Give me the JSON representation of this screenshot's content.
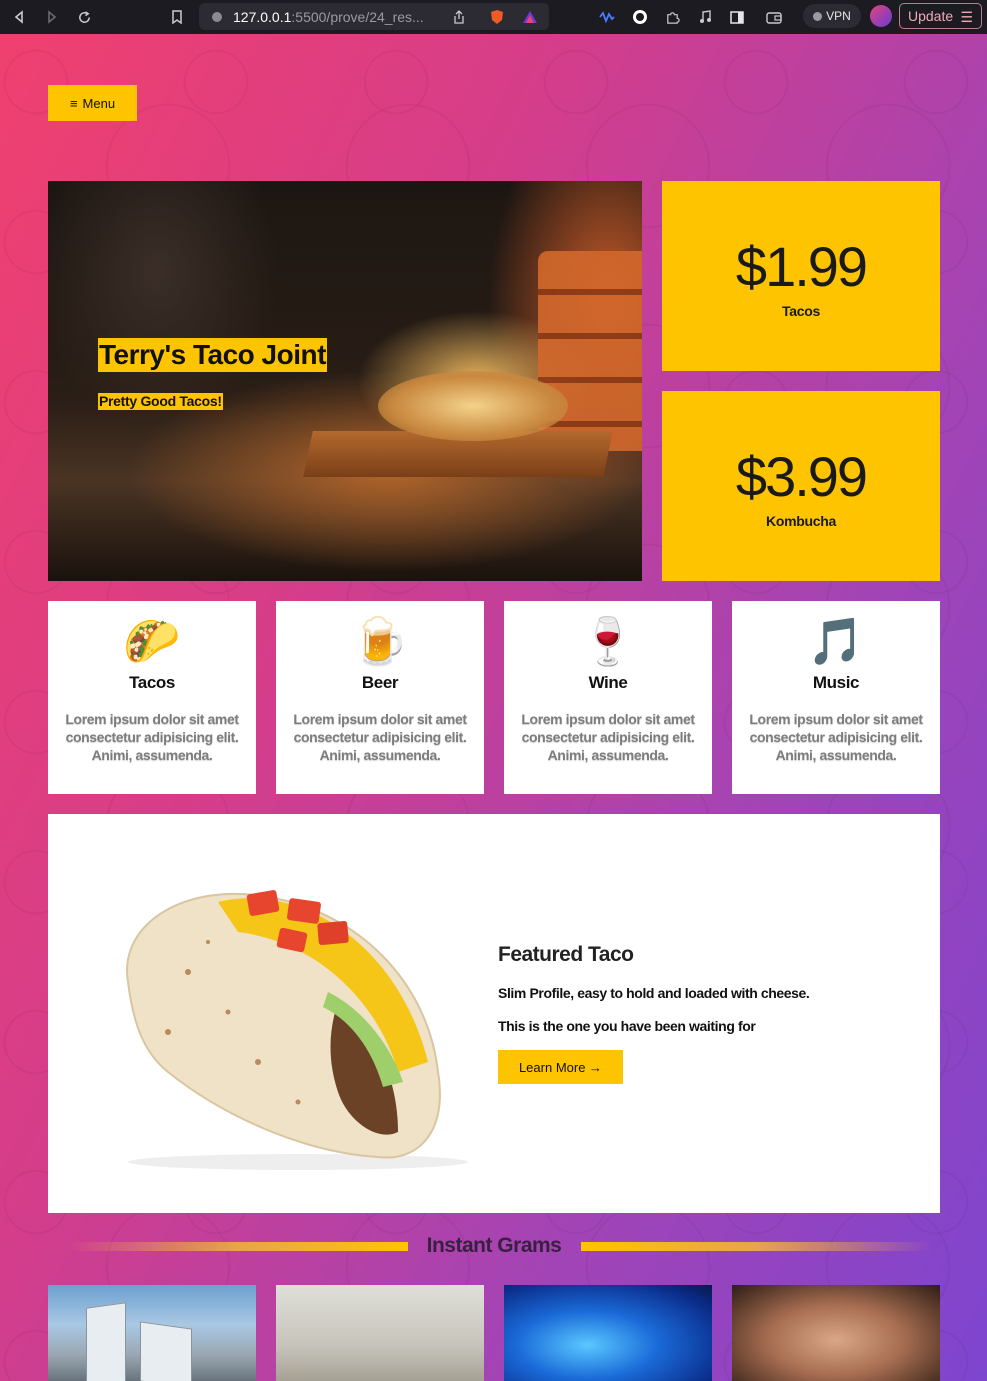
{
  "browser": {
    "url_host": "127.0.0.1",
    "url_path": ":5500/prove/24_res...",
    "vpn_label": "VPN",
    "update_label": "Update"
  },
  "nav": {
    "menu_label": "Menu",
    "menu_icon": "hamburger-icon"
  },
  "hero": {
    "title": "Terry's Taco Joint",
    "subtitle": "Pretty Good Tacos!"
  },
  "prices": [
    {
      "amount": "$1.99",
      "label": "Tacos"
    },
    {
      "amount": "$3.99",
      "label": "Kombucha"
    }
  ],
  "features": [
    {
      "emoji": "🌮",
      "name": "Tacos",
      "desc": "Lorem ipsum dolor sit amet consectetur adipisicing elit. Animi, assumenda."
    },
    {
      "emoji": "🍺",
      "name": "Beer",
      "desc": "Lorem ipsum dolor sit amet consectetur adipisicing elit. Animi, assumenda."
    },
    {
      "emoji": "🍷",
      "name": "Wine",
      "desc": "Lorem ipsum dolor sit amet consectetur adipisicing elit. Animi, assumenda."
    },
    {
      "emoji": "🎵",
      "name": "Music",
      "desc": "Lorem ipsum dolor sit amet consectetur adipisicing elit. Animi, assumenda."
    }
  ],
  "featured": {
    "title": "Featured Taco",
    "line1": "Slim Profile, easy to hold and loaded with cheese.",
    "line2": "This is the one you have been waiting for",
    "button_label": "Learn More →"
  },
  "grams": {
    "title": "Instant Grams"
  },
  "colors": {
    "accent": "#ffc400",
    "gradient_start": "#f0406f",
    "gradient_end": "#7e45cf"
  }
}
